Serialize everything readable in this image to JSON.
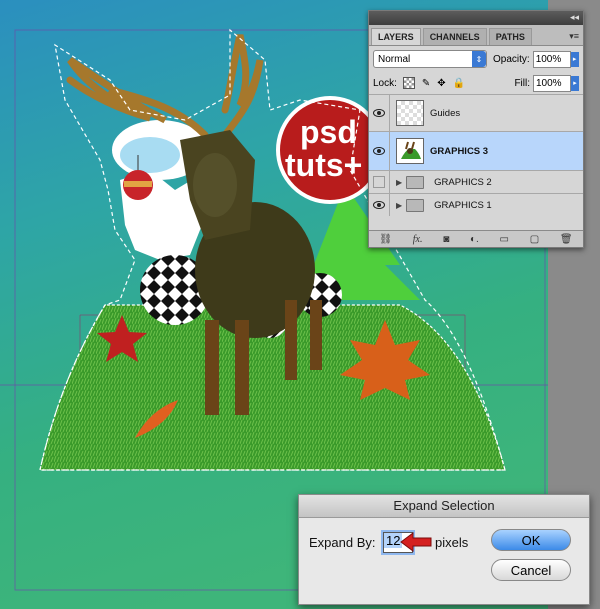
{
  "layers_panel": {
    "tabs": [
      "LAYERS",
      "CHANNELS",
      "PATHS"
    ],
    "menu_icon": "panel-menu-icon",
    "blend_mode": "Normal",
    "opacity_label": "Opacity:",
    "opacity_value": "100%",
    "lock_label": "Lock:",
    "fill_label": "Fill:",
    "fill_value": "100%",
    "layers": [
      {
        "name": "Guides",
        "visible": true,
        "type": "layer"
      },
      {
        "name": "GRAPHICS 3",
        "visible": true,
        "type": "layer",
        "selected": true
      },
      {
        "name": "GRAPHICS 2",
        "visible": false,
        "type": "group"
      },
      {
        "name": "GRAPHICS 1",
        "visible": true,
        "type": "group"
      }
    ],
    "bottom_icons": [
      "link-icon",
      "fx-icon",
      "mask-icon",
      "adjustment-icon",
      "folder-icon",
      "new-layer-icon",
      "trash-icon"
    ],
    "bottom_glyphs": [
      "⛓",
      "fx.",
      "◙",
      "◐.",
      "▭",
      "▢",
      "🗑"
    ]
  },
  "dialog": {
    "title": "Expand Selection",
    "expand_label": "Expand By:",
    "expand_value": "12",
    "unit": "pixels",
    "ok_label": "OK",
    "cancel_label": "Cancel"
  },
  "artwork": {
    "logo_line1": "psd",
    "logo_line2": "tuts+"
  },
  "colors": {
    "selected_layer": "#b8d6fb",
    "accent": "#3a79d4",
    "arrow_red": "#d42020"
  }
}
